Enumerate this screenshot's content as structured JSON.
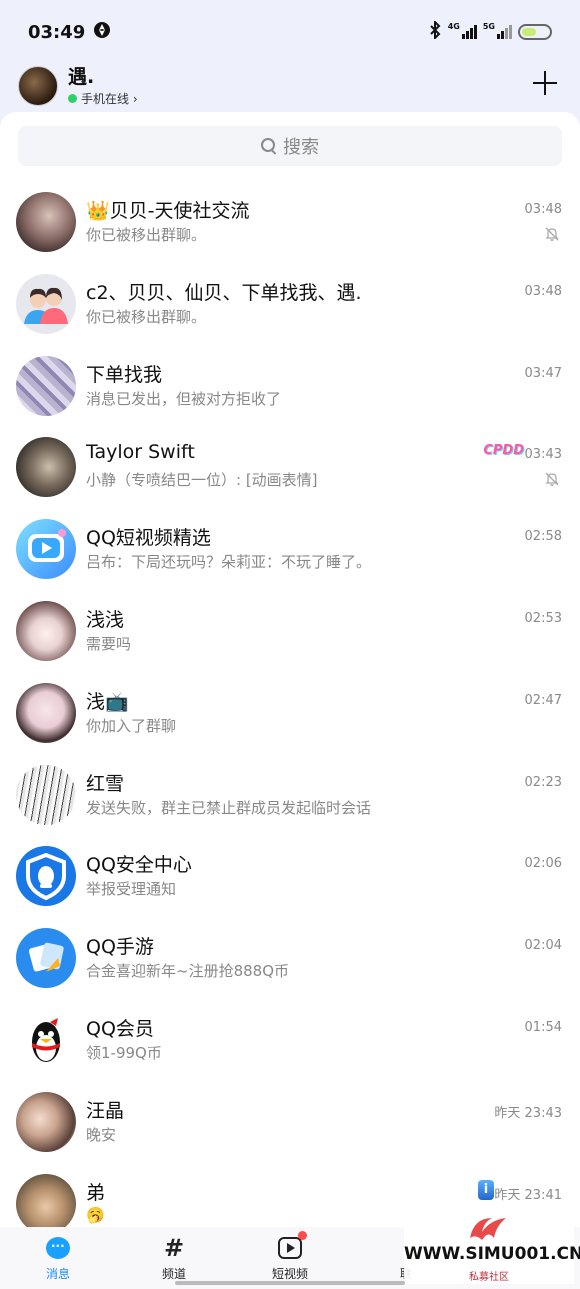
{
  "status": {
    "time": "03:49",
    "net1": "4G",
    "net2": "5G"
  },
  "header": {
    "name": "遇.",
    "status": "手机在线 ›"
  },
  "search": {
    "placeholder": "搜索"
  },
  "chats": [
    {
      "title": "👑贝贝-天使社交流",
      "preview": "你已被移出群聊。",
      "time": "03:48",
      "muted": true,
      "avatar": "woman-photo"
    },
    {
      "title": "c2、贝贝、仙贝、下单找我、遇.",
      "preview": "你已被移出群聊。",
      "time": "03:48",
      "muted": false,
      "avatar": "group-avatar"
    },
    {
      "title": "下单找我",
      "preview": "消息已发出，但被对方拒收了",
      "time": "03:47",
      "muted": false,
      "avatar": "plaid-skirt-photo"
    },
    {
      "title": "Taylor Swift",
      "preview": "小静（专喷结巴一位）: [动画表情]",
      "time": "03:43",
      "muted": true,
      "badge": "CPDD",
      "avatar": "portrait-photo"
    },
    {
      "title": "QQ短视频精选",
      "preview": "吕布：下局还玩吗？朵莉亚：不玩了睡了。",
      "time": "02:58",
      "muted": false,
      "avatar": "video-app-icon"
    },
    {
      "title": "浅浅",
      "preview": "需要吗",
      "time": "02:53",
      "muted": false,
      "avatar": "anime-girl"
    },
    {
      "title": "浅📺",
      "preview": "你加入了群聊",
      "time": "02:47",
      "muted": false,
      "avatar": "girl-photo"
    },
    {
      "title": "红雪",
      "preview": "发送失败，群主已禁止群成员发起临时会话",
      "time": "02:23",
      "muted": false,
      "avatar": "ink-drawing"
    },
    {
      "title": "QQ安全中心",
      "preview": "举报受理通知",
      "time": "02:06",
      "muted": false,
      "avatar": "security-shield-icon"
    },
    {
      "title": "QQ手游",
      "preview": "合金喜迎新年~注册抢888Q币",
      "time": "02:04",
      "muted": false,
      "avatar": "game-icon"
    },
    {
      "title": "QQ会员",
      "preview": "领1-99Q币",
      "time": "01:54",
      "muted": false,
      "avatar": "penguin-icon"
    },
    {
      "title": "汪晶",
      "preview": "晚安",
      "time": "昨天 23:43",
      "muted": false,
      "avatar": "girl-cat-photo"
    },
    {
      "title": "弟",
      "preview": "🥱",
      "time": "昨天 23:41",
      "muted": false,
      "badge_i": "i",
      "avatar": "kitten-photo"
    }
  ],
  "tabs": [
    {
      "label": "消息",
      "icon": "message-icon",
      "active": true
    },
    {
      "label": "频道",
      "icon": "hash-icon",
      "active": false
    },
    {
      "label": "短视频",
      "icon": "video-icon",
      "active": false
    },
    {
      "label": "联",
      "icon": "contacts-icon",
      "active": false
    }
  ],
  "watermark": {
    "text": "WWW.SIMU001.CN",
    "sub": "私募社区"
  }
}
